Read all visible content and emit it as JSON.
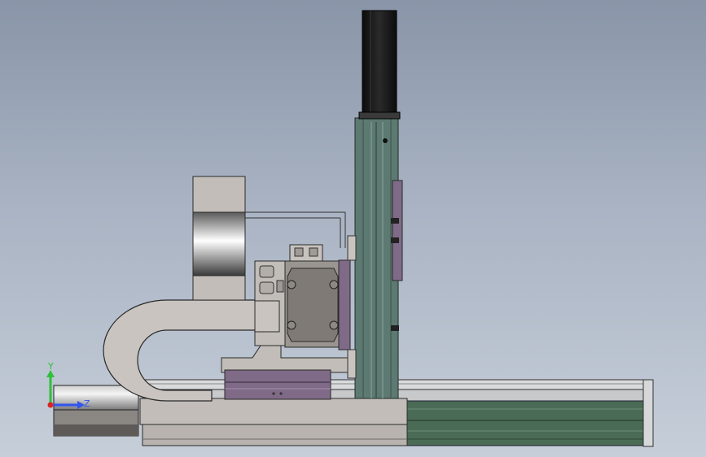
{
  "triad": {
    "y_label": "Y",
    "z_label": "Z",
    "y_color": "#2fbf3a",
    "z_color": "#3355ee",
    "x_color": "#dd2222"
  },
  "colors": {
    "rail_green": "#4a6b55",
    "column_teal": "#5d7a72",
    "motor_black": "#141414",
    "carriage_purple": "#7f6a87",
    "chain_gray": "#c9c4c0",
    "housing_gray": "#c2bdb8"
  }
}
